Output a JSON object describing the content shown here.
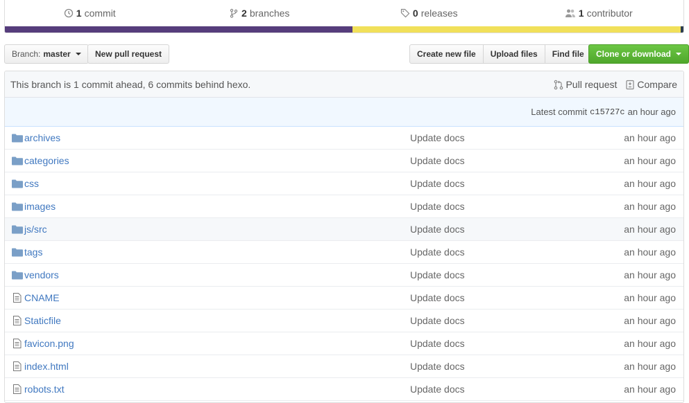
{
  "summary": {
    "commits": {
      "num": "1",
      "label": "commit"
    },
    "branches": {
      "num": "2",
      "label": "branches"
    },
    "releases": {
      "num": "0",
      "label": "releases"
    },
    "contributors": {
      "num": "1",
      "label": "contributor"
    }
  },
  "languages": [
    {
      "color": "#563d7c",
      "fraction": 0.512
    },
    {
      "color": "#f1e05a",
      "fraction": 0.484
    },
    {
      "color": "#2c3e50",
      "fraction": 0.004
    }
  ],
  "toolbar": {
    "branch_prefix": "Branch:",
    "branch_name": "master",
    "new_pull_request": "New pull request",
    "create_new_file": "Create new file",
    "upload_files": "Upload files",
    "find_file": "Find file",
    "clone_or_download": "Clone or download"
  },
  "branch_info": {
    "message": "This branch is 1 commit ahead, 6 commits behind hexo.",
    "pull_request": "Pull request",
    "compare": "Compare"
  },
  "latest_commit": {
    "label": "Latest commit",
    "sha": "c15727c",
    "age": "an hour ago"
  },
  "files": [
    {
      "type": "folder",
      "name": "archives",
      "message": "Update docs",
      "age": "an hour ago"
    },
    {
      "type": "folder",
      "name": "categories",
      "message": "Update docs",
      "age": "an hour ago"
    },
    {
      "type": "folder",
      "name": "css",
      "message": "Update docs",
      "age": "an hour ago"
    },
    {
      "type": "folder",
      "name": "images",
      "message": "Update docs",
      "age": "an hour ago"
    },
    {
      "type": "folder",
      "name": "js/src",
      "message": "Update docs",
      "age": "an hour ago"
    },
    {
      "type": "folder",
      "name": "tags",
      "message": "Update docs",
      "age": "an hour ago"
    },
    {
      "type": "folder",
      "name": "vendors",
      "message": "Update docs",
      "age": "an hour ago"
    },
    {
      "type": "file",
      "name": "CNAME",
      "message": "Update docs",
      "age": "an hour ago"
    },
    {
      "type": "file",
      "name": "Staticfile",
      "message": "Update docs",
      "age": "an hour ago"
    },
    {
      "type": "file",
      "name": "favicon.png",
      "message": "Update docs",
      "age": "an hour ago"
    },
    {
      "type": "file",
      "name": "index.html",
      "message": "Update docs",
      "age": "an hour ago"
    },
    {
      "type": "file",
      "name": "robots.txt",
      "message": "Update docs",
      "age": "an hour ago"
    }
  ],
  "colors": {
    "link": "#4078c0",
    "folder_icon": "#7a9fc7",
    "file_icon": "#777777",
    "clone_button": "#6cc644"
  }
}
